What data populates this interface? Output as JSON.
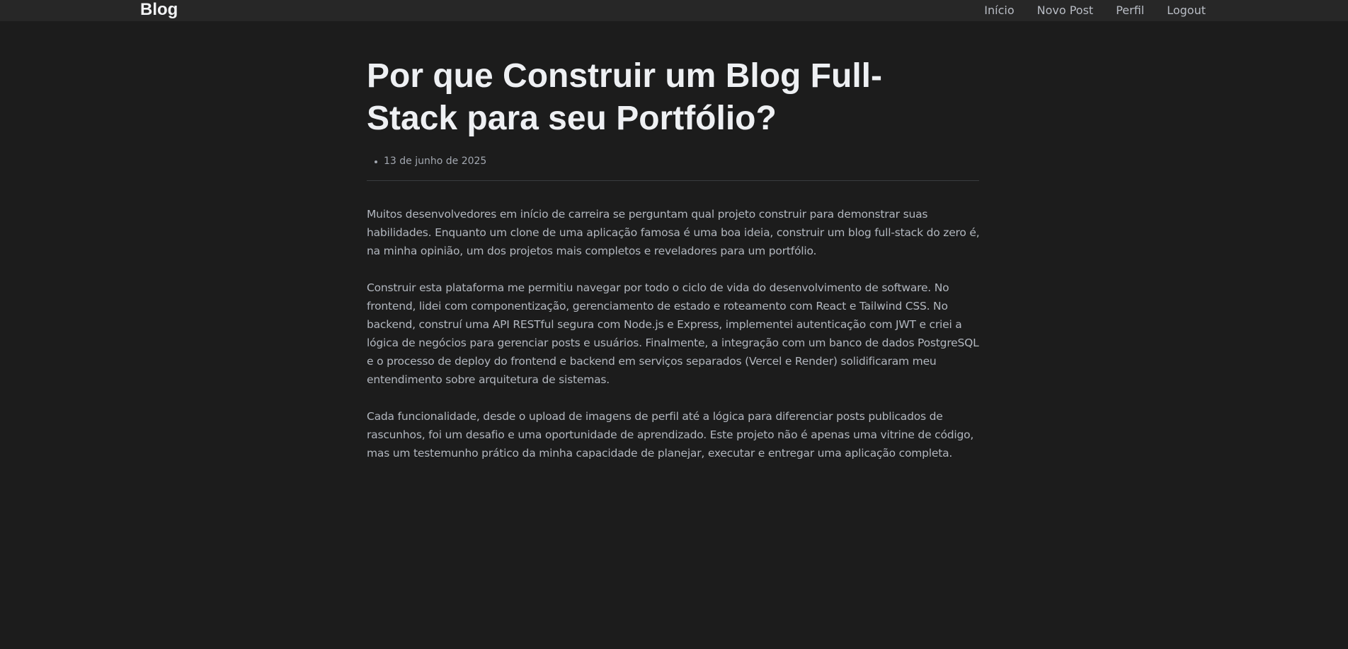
{
  "navbar": {
    "brand": "Blog",
    "links": [
      {
        "label": "Início"
      },
      {
        "label": "Novo Post"
      },
      {
        "label": "Perfil"
      },
      {
        "label": "Logout"
      }
    ]
  },
  "post": {
    "title": "Por que Construir um Blog Full-Stack para seu Portfólio?",
    "date": "13 de junho de 2025",
    "paragraphs": [
      "Muitos desenvolvedores em início de carreira se perguntam qual projeto construir para demonstrar suas habilidades. Enquanto um clone de uma aplicação famosa é uma boa ideia, construir um blog full-stack do zero é, na minha opinião, um dos projetos mais completos e reveladores para um portfólio.",
      "Construir esta plataforma me permitiu navegar por todo o ciclo de vida do desenvolvimento de software. No frontend, lidei com componentização, gerenciamento de estado e roteamento com React e Tailwind CSS. No backend, construí uma API RESTful segura com Node.js e Express, implementei autenticação com JWT e criei a lógica de negócios para gerenciar posts e usuários. Finalmente, a integração com um banco de dados PostgreSQL e o processo de deploy do frontend e backend em serviços separados (Vercel e Render) solidificaram meu entendimento sobre arquitetura de sistemas.",
      "Cada funcionalidade, desde o upload de imagens de perfil até a lógica para diferenciar posts publicados de rascunhos, foi um desafio e uma oportunidade de aprendizado. Este projeto não é apenas uma vitrine de código, mas um testemunho prático da minha capacidade de planejar, executar e entregar uma aplicação completa."
    ]
  },
  "colors": {
    "background": "#1c1c1c",
    "navbar": "#272727",
    "title": "#eef0f3",
    "body_text": "#b2b7bf"
  }
}
